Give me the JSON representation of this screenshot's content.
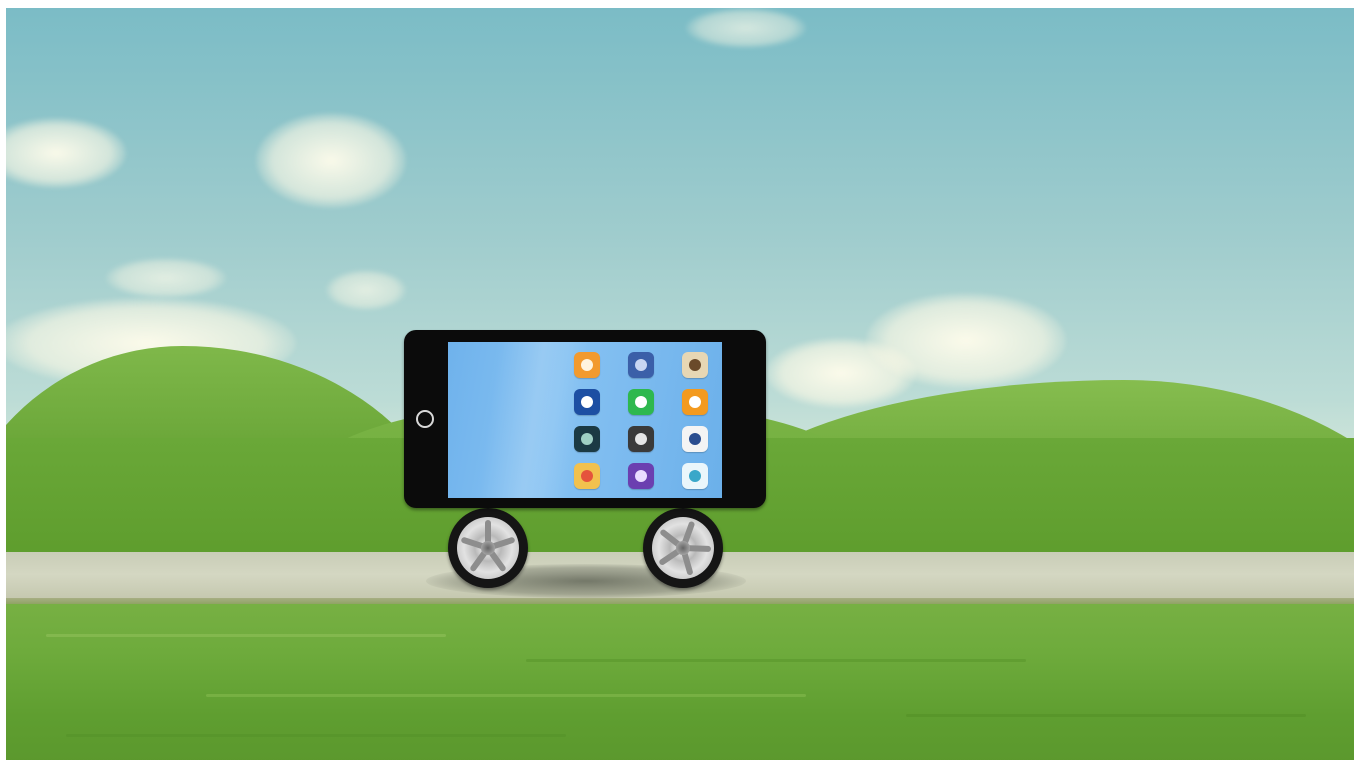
{
  "scene": {
    "subject": "smartphone-on-wheels",
    "colors": {
      "sky_top": "#7bbcc6",
      "grass": "#6aa838",
      "road": "#cfd2bd",
      "phone_body": "#0b0b0b",
      "screen": "#7ebcf0"
    }
  },
  "phone": {
    "orientation": "landscape",
    "apps": [
      {
        "icon": "orange-app-icon",
        "color": "#f29a2e",
        "glyph": "#fff4de"
      },
      {
        "icon": "blue-spiral-app-icon",
        "color": "#3b5fa8",
        "glyph": "#c9d6f2"
      },
      {
        "icon": "photo-person-app-icon",
        "color": "#e7d7b4",
        "glyph": "#6a4a2a"
      },
      {
        "icon": "dots-grid-app-icon",
        "color": "#1d4fa3",
        "glyph": "#ffffff"
      },
      {
        "icon": "green-leaf-app-icon",
        "color": "#2eb84e",
        "glyph": "#ffffff"
      },
      {
        "icon": "orange-cloud-app-icon",
        "color": "#f39a1f",
        "glyph": "#ffffff"
      },
      {
        "icon": "dark-book-app-icon",
        "color": "#1b3a44",
        "glyph": "#9fd0c4"
      },
      {
        "icon": "camera-lens-app-icon",
        "color": "#3a3a3a",
        "glyph": "#e6e6e6"
      },
      {
        "icon": "blue-yellow-app-icon",
        "color": "#f4f4f4",
        "glyph": "#2a4d8f"
      },
      {
        "icon": "colorful-photos-app-icon",
        "color": "#f2c14e",
        "glyph": "#e5533c"
      },
      {
        "icon": "purple-app-icon",
        "color": "#6b3fb0",
        "glyph": "#e9dcff"
      },
      {
        "icon": "teal-circle-app-icon",
        "color": "#eaf6fb",
        "glyph": "#3aa7c9"
      }
    ]
  }
}
